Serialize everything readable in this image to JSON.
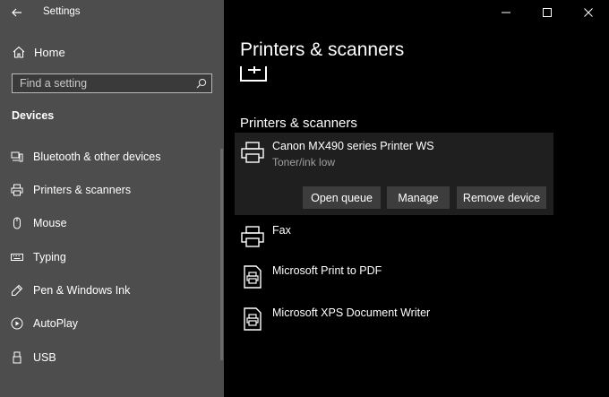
{
  "window": {
    "app_title": "Settings",
    "controls": [
      "minimize",
      "maximize",
      "close"
    ]
  },
  "sidebar": {
    "home_label": "Home",
    "search_placeholder": "Find a setting",
    "section_title": "Devices",
    "items": [
      {
        "label": "Bluetooth & other devices",
        "icon": "bluetooth-devices-icon"
      },
      {
        "label": "Printers & scanners",
        "icon": "printer-icon",
        "selected": true
      },
      {
        "label": "Mouse",
        "icon": "mouse-icon"
      },
      {
        "label": "Typing",
        "icon": "keyboard-icon"
      },
      {
        "label": "Pen & Windows Ink",
        "icon": "pen-icon"
      },
      {
        "label": "AutoPlay",
        "icon": "autoplay-icon"
      },
      {
        "label": "USB",
        "icon": "usb-icon"
      }
    ]
  },
  "main": {
    "page_title": "Printers & scanners",
    "list_title": "Printers & scanners",
    "printers": [
      {
        "name": "Canon MX490 series Printer WS",
        "status": "Toner/ink low",
        "selected": true,
        "icon": "printer-icon"
      },
      {
        "name": "Fax",
        "icon": "fax-printer-icon"
      },
      {
        "name": "Microsoft Print to PDF",
        "icon": "document-printer-icon"
      },
      {
        "name": "Microsoft XPS Document Writer",
        "icon": "document-printer-icon"
      }
    ],
    "actions": {
      "open_queue": "Open queue",
      "manage": "Manage",
      "remove_device": "Remove device"
    }
  },
  "colors": {
    "sidebar_bg": "#4d4d4d",
    "main_bg": "#000000",
    "card_bg": "#1f1f1f",
    "button_bg": "#3d3d3d",
    "secondary_text": "#a0a0a0"
  }
}
